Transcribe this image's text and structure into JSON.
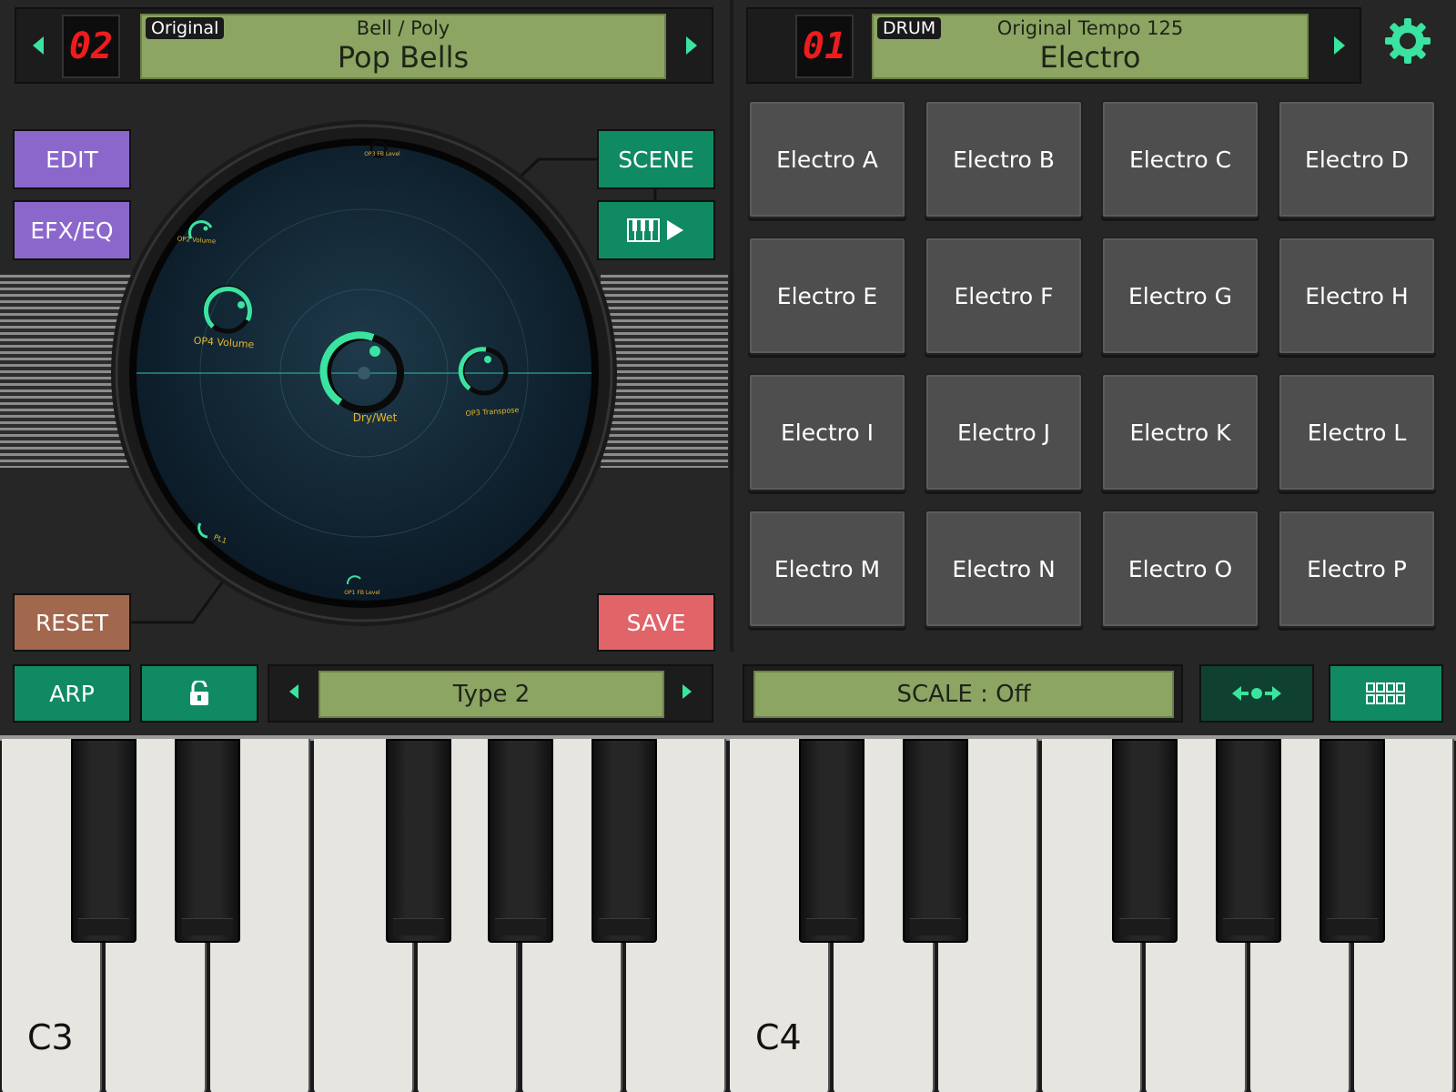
{
  "left_preset": {
    "number": "02",
    "tag": "Original",
    "category": "Bell / Poly",
    "name": "Pop Bells"
  },
  "right_preset": {
    "number": "01",
    "tag": "DRUM",
    "category": "Original Tempo 125",
    "name": "Electro"
  },
  "buttons": {
    "edit": "EDIT",
    "efx_eq": "EFX/EQ",
    "scene": "SCENE",
    "reset": "RESET",
    "save": "SAVE",
    "arp": "ARP"
  },
  "scene_knobs": {
    "center": "Dry/Wet",
    "op4_volume": "OP4 Volume",
    "op3_transpose": "OP3 Transpose",
    "op2_volume": "OP2 Volume",
    "op3_fb_level": "OP3 FB Level",
    "op1_fb_level": "OP1 FB Level",
    "pl1": "PL1"
  },
  "arp_type": "Type 2",
  "scale": "SCALE : Off",
  "pads": [
    "Electro A",
    "Electro B",
    "Electro C",
    "Electro D",
    "Electro E",
    "Electro F",
    "Electro G",
    "Electro H",
    "Electro I",
    "Electro J",
    "Electro K",
    "Electro L",
    "Electro M",
    "Electro N",
    "Electro O",
    "Electro P"
  ],
  "keyboard": {
    "label_c3": "C3",
    "label_c4": "C4"
  },
  "colors": {
    "accent": "#3be3a0",
    "lcd": "#8ca563",
    "segment": "#ee1c1c"
  }
}
